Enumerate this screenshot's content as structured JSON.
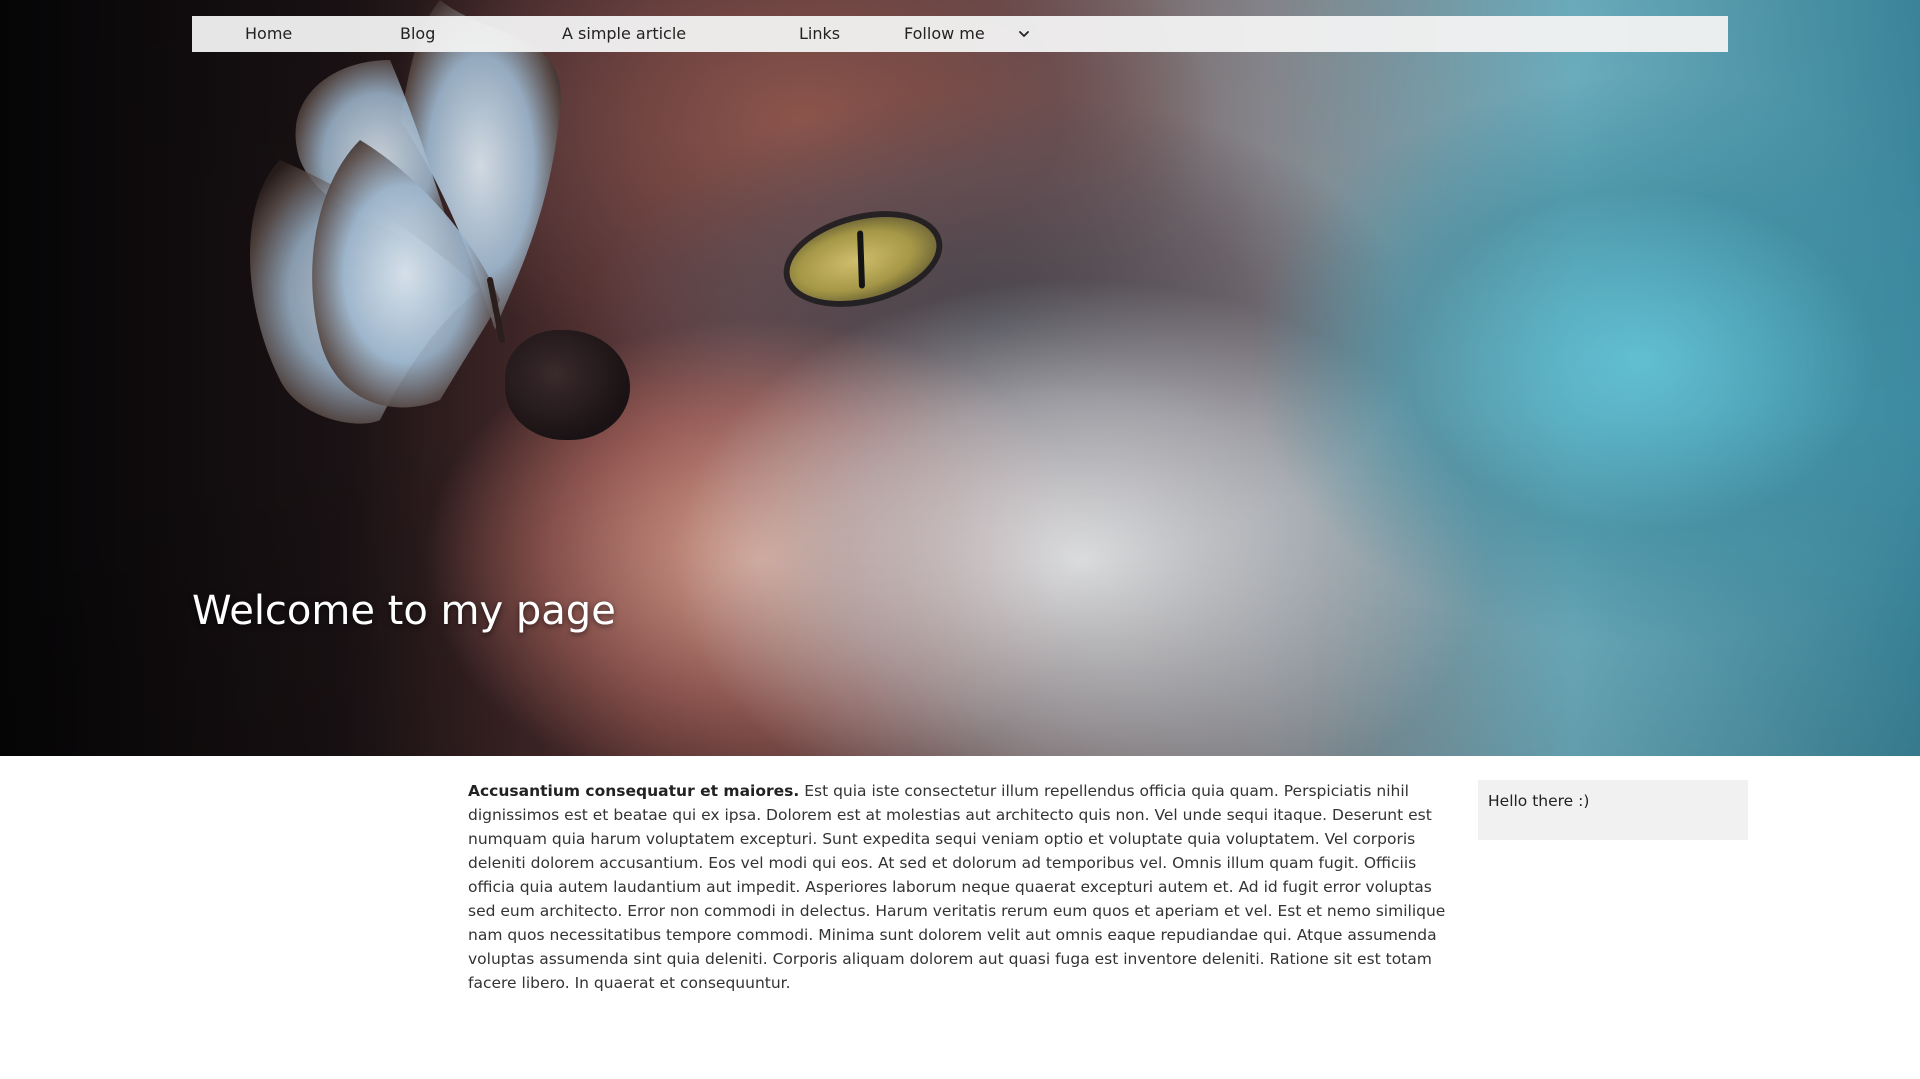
{
  "nav": {
    "items": [
      {
        "label": "Home"
      },
      {
        "label": "Blog"
      },
      {
        "label": "A simple article"
      },
      {
        "label": "Links"
      },
      {
        "label": "Follow me"
      }
    ],
    "dropdown_icon": "chevron-down-icon"
  },
  "hero": {
    "title": "Welcome to my page"
  },
  "article": {
    "lead": "Accusantium consequatur et maiores.",
    "body": "Est quia iste consectetur illum repellendus officia quia quam. Perspiciatis nihil dignissimos est et beatae qui ex ipsa. Dolorem est at molestias aut architecto quis non. Vel unde sequi itaque. Deserunt est numquam quia harum voluptatem excepturi. Sunt expedita sequi veniam optio et voluptate quia voluptatem. Vel corporis deleniti dolorem accusantium. Eos vel modi qui eos. At sed et dolorum ad temporibus vel. Omnis illum quam fugit. Officiis officia quia autem laudantium aut impedit. Asperiores laborum neque quaerat excepturi autem et. Ad id fugit error voluptas sed eum architecto. Error non commodi in delectus. Harum veritatis rerum eum quos et aperiam et vel. Est et nemo similique nam quos necessitatibus tempore commodi. Minima sunt dolorem velit aut omnis eaque repudiandae qui. Atque assumenda voluptas assumenda sint quia deleniti. Corporis aliquam dolorem aut quasi fuga est inventore deleniti. Ratione sit est totam facere libero. In quaerat et consequuntur."
  },
  "sidebar": {
    "text": "Hello there :)"
  },
  "colors": {
    "navbar_bg": "#f2f2f2",
    "sidebar_bg": "#f1f1f1",
    "text": "#333333"
  }
}
